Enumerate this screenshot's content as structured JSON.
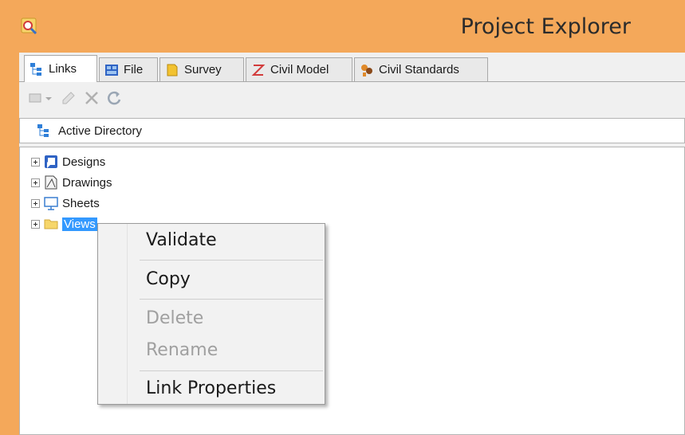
{
  "window": {
    "title": "Project Explorer",
    "frame_color": "#f4a85a"
  },
  "tabs": [
    {
      "label": "Links",
      "active": true,
      "icon": "links-icon"
    },
    {
      "label": "File",
      "active": false,
      "icon": "file-icon"
    },
    {
      "label": "Survey",
      "active": false,
      "icon": "survey-icon"
    },
    {
      "label": "Civil Model",
      "active": false,
      "icon": "civil-model-icon"
    },
    {
      "label": "Civil Standards",
      "active": false,
      "icon": "civil-standards-icon"
    }
  ],
  "toolbar": {
    "buttons": [
      "new-link-icon",
      "edit-icon",
      "delete-icon",
      "refresh-icon"
    ]
  },
  "pathbar": {
    "label": "Active Directory"
  },
  "tree": {
    "nodes": [
      {
        "label": "Designs",
        "icon": "designs-icon"
      },
      {
        "label": "Drawings",
        "icon": "drawings-icon"
      },
      {
        "label": "Sheets",
        "icon": "sheets-icon"
      },
      {
        "label": "Views",
        "icon": "folder-icon",
        "selected": true
      }
    ]
  },
  "context_menu": {
    "items": [
      {
        "label": "Validate",
        "enabled": true
      },
      {
        "label": "Copy",
        "enabled": true
      },
      {
        "label": "Delete",
        "enabled": false
      },
      {
        "label": "Rename",
        "enabled": false
      },
      {
        "label": "Link Properties",
        "enabled": true
      }
    ]
  },
  "colors": {
    "selection": "#3399ff",
    "disabled_text": "#a0a0a0"
  }
}
